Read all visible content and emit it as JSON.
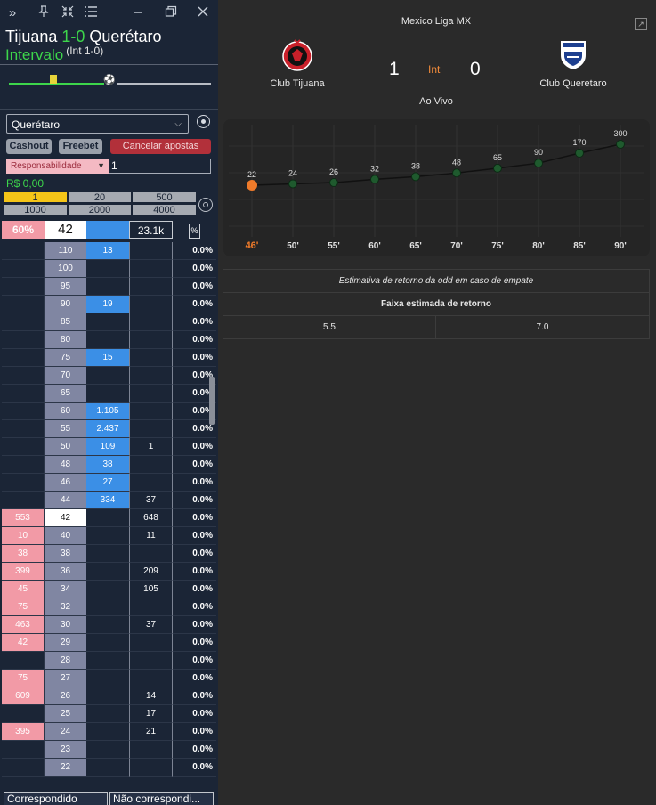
{
  "match": {
    "home_short": "Tijuana",
    "score_text": "1-0",
    "away_short": "Querétaro",
    "status": "Intervalo",
    "half_score": "(Int 1-0)"
  },
  "controls": {
    "market_selected": "Querétaro",
    "cashout": "Cashout",
    "freebet": "Freebet",
    "cancel": "Cancelar apostas",
    "resp_label": "Responsabilidade",
    "stake_value": "1",
    "balance": "R$ 0,00",
    "chips": [
      "1",
      "20",
      "500",
      "1000",
      "2000",
      "4000"
    ]
  },
  "ladder_header": {
    "pct": "60%",
    "price": "42",
    "volume": "23.1k"
  },
  "ladder": [
    {
      "lay": "",
      "price": "110",
      "back": "13",
      "traded": "",
      "pct": "0.0%"
    },
    {
      "lay": "",
      "price": "100",
      "back": "",
      "traded": "",
      "pct": "0.0%"
    },
    {
      "lay": "",
      "price": "95",
      "back": "",
      "traded": "",
      "pct": "0.0%"
    },
    {
      "lay": "",
      "price": "90",
      "back": "19",
      "traded": "",
      "pct": "0.0%"
    },
    {
      "lay": "",
      "price": "85",
      "back": "",
      "traded": "",
      "pct": "0.0%"
    },
    {
      "lay": "",
      "price": "80",
      "back": "",
      "traded": "",
      "pct": "0.0%"
    },
    {
      "lay": "",
      "price": "75",
      "back": "15",
      "traded": "",
      "pct": "0.0%"
    },
    {
      "lay": "",
      "price": "70",
      "back": "",
      "traded": "",
      "pct": "0.0%"
    },
    {
      "lay": "",
      "price": "65",
      "back": "",
      "traded": "",
      "pct": "0.0%"
    },
    {
      "lay": "",
      "price": "60",
      "back": "1.105",
      "traded": "",
      "pct": "0.0%"
    },
    {
      "lay": "",
      "price": "55",
      "back": "2.437",
      "traded": "",
      "pct": "0.0%"
    },
    {
      "lay": "",
      "price": "50",
      "back": "109",
      "traded": "1",
      "pct": "0.0%"
    },
    {
      "lay": "",
      "price": "48",
      "back": "38",
      "traded": "",
      "pct": "0.0%"
    },
    {
      "lay": "",
      "price": "46",
      "back": "27",
      "traded": "",
      "pct": "0.0%"
    },
    {
      "lay": "",
      "price": "44",
      "back": "334",
      "traded": "37",
      "pct": "0.0%"
    },
    {
      "lay": "553",
      "price": "42",
      "back": "",
      "traded": "648",
      "pct": "0.0%",
      "current": true
    },
    {
      "lay": "10",
      "price": "40",
      "back": "",
      "traded": "11",
      "pct": "0.0%"
    },
    {
      "lay": "38",
      "price": "38",
      "back": "",
      "traded": "",
      "pct": "0.0%"
    },
    {
      "lay": "399",
      "price": "36",
      "back": "",
      "traded": "209",
      "pct": "0.0%"
    },
    {
      "lay": "45",
      "price": "34",
      "back": "",
      "traded": "105",
      "pct": "0.0%"
    },
    {
      "lay": "75",
      "price": "32",
      "back": "",
      "traded": "",
      "pct": "0.0%"
    },
    {
      "lay": "463",
      "price": "30",
      "back": "",
      "traded": "37",
      "pct": "0.0%"
    },
    {
      "lay": "42",
      "price": "29",
      "back": "",
      "traded": "",
      "pct": "0.0%"
    },
    {
      "lay": "",
      "price": "28",
      "back": "",
      "traded": "",
      "pct": "0.0%"
    },
    {
      "lay": "75",
      "price": "27",
      "back": "",
      "traded": "",
      "pct": "0.0%"
    },
    {
      "lay": "609",
      "price": "26",
      "back": "",
      "traded": "14",
      "pct": "0.0%"
    },
    {
      "lay": "",
      "price": "25",
      "back": "",
      "traded": "17",
      "pct": "0.0%"
    },
    {
      "lay": "395",
      "price": "24",
      "back": "",
      "traded": "21",
      "pct": "0.0%"
    },
    {
      "lay": "",
      "price": "23",
      "back": "",
      "traded": "",
      "pct": "0.0%"
    },
    {
      "lay": "",
      "price": "22",
      "back": "",
      "traded": "",
      "pct": "0.0%"
    }
  ],
  "footer": {
    "matched": "Correspondido",
    "unmatched": "Não correspondi..."
  },
  "scoreboard": {
    "league": "Mexico Liga MX",
    "home_team": "Club Tijuana",
    "away_team": "Club Queretaro",
    "home_score": "1",
    "away_score": "0",
    "period": "Int",
    "live": "Ao Vivo"
  },
  "chart_data": {
    "type": "line",
    "categories": [
      "46'",
      "50'",
      "55'",
      "60'",
      "65'",
      "70'",
      "75'",
      "80'",
      "85'",
      "90'"
    ],
    "values": [
      22,
      24,
      26,
      32,
      38,
      48,
      65,
      90,
      170,
      300
    ],
    "highlight_index": 0,
    "colors": {
      "point": "#1f5a2e",
      "highlight": "#f07b2a",
      "line": "#111111",
      "label": "#dddddd"
    }
  },
  "return_table": {
    "caption": "Estimativa de retorno da odd em caso de empate",
    "header": "Faixa estimada de retorno",
    "low": "5.5",
    "high": "7.0"
  },
  "colors": {
    "panel": "#1b2536",
    "accent_green": "#3dd64b",
    "lay": "#f29aa6",
    "back": "#3b8fe6",
    "cancel": "#b2303a"
  }
}
